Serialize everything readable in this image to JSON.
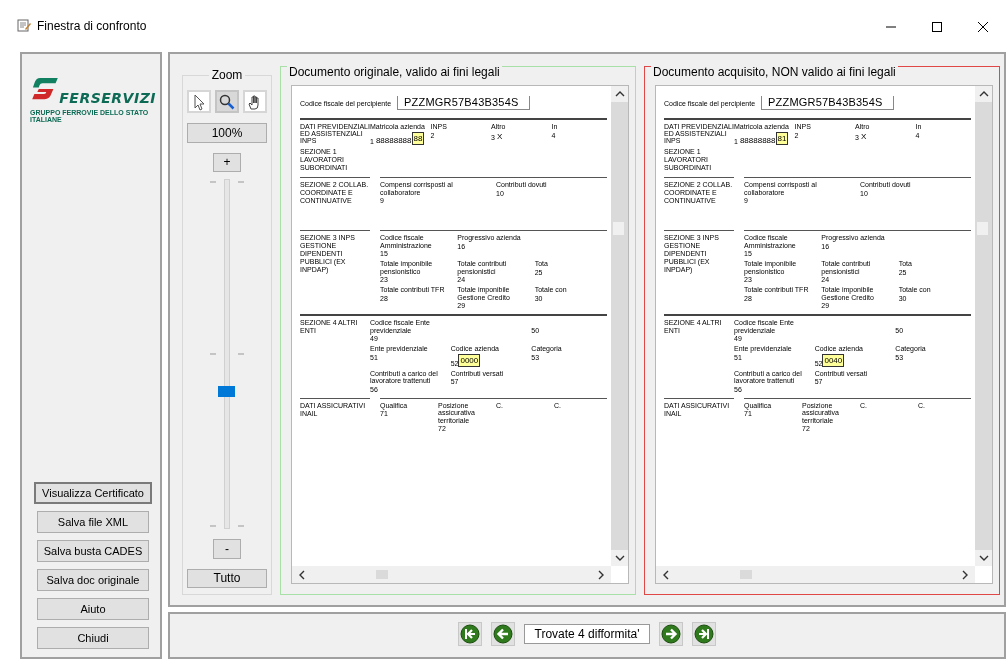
{
  "window": {
    "title": "Finestra di confronto"
  },
  "sidebar": {
    "logo": {
      "name": "FERSERVIZI",
      "tagline": "GRUPPO FERROVIE DELLO STATO ITALIANE"
    },
    "buttons": [
      {
        "label": "Visualizza Certificato",
        "focused": true
      },
      {
        "label": "Salva file XML",
        "focused": false
      },
      {
        "label": "Salva busta CADES",
        "focused": false
      },
      {
        "label": "Salva doc originale",
        "focused": false
      },
      {
        "label": "Aiuto",
        "focused": false
      },
      {
        "label": "Chiudi",
        "focused": false
      }
    ]
  },
  "zoom": {
    "title": "Zoom",
    "tools": [
      {
        "kind": "pointer",
        "selected": false
      },
      {
        "kind": "magnifier",
        "selected": true
      },
      {
        "kind": "hand",
        "selected": false
      }
    ],
    "percent": "100%",
    "plus": "+",
    "minus": "-",
    "level": 0.39,
    "fit": "Tutto"
  },
  "documents": [
    {
      "title": "Documento originale, valido ai fini legali",
      "color": "#a8e0a8",
      "fiscal_label": "Codice fiscale del percipiente",
      "fiscal_code": "PZZMGR57B43B354S",
      "sections": [
        {
          "heading": "DATI PREVIDENZIALI ED ASSISTENZIALI INPS",
          "label": "SEZIONE 1 LAVORATORI SUBORDINATI",
          "rows": [
            [
              {
                "caption": "Matricola azienda",
                "num": "1",
                "value": "88888888",
                "diff": "88"
              },
              {
                "caption": "INPS",
                "num": "2"
              },
              {
                "caption": "Altro",
                "num": "3",
                "value": "X"
              },
              {
                "caption": "In",
                "num": "4"
              }
            ]
          ]
        },
        {
          "label": "SEZIONE 2 COLLAB. COORDINATE E CONTINUATIVE",
          "rows": [
            [
              {
                "caption": "Compensi corrisposti al collaboratore",
                "num": "9"
              },
              {
                "caption": "Contributi dovuti",
                "num": "10"
              }
            ]
          ]
        },
        {
          "label": "SEZIONE 3 INPS GESTIONE DIPENDENTI PUBBLICI (EX INPDAP)",
          "rows": [
            [
              {
                "caption": "Codice fiscale Amministrazione",
                "num": "15"
              },
              {
                "caption": "Progressivo azienda",
                "num": "16"
              }
            ],
            [
              {
                "caption": "Totale imponibile pensionistico",
                "num": "23"
              },
              {
                "caption": "Totale contributi pensionistici",
                "num": "24"
              },
              {
                "caption": "Tota",
                "num": "25"
              }
            ],
            [
              {
                "caption": "Totale contributi TFR",
                "num": "28"
              },
              {
                "caption": "Totale imponibile Gestione Credito",
                "num": "29"
              },
              {
                "caption": "Totale con",
                "num": "30"
              }
            ]
          ]
        },
        {
          "label": "SEZIONE 4 ALTRI ENTI",
          "rows": [
            [
              {
                "caption": "Codice fiscale Ente previdenziale",
                "num": "49"
              },
              "",
              {
                "num": "50"
              }
            ],
            [
              {
                "caption": "Ente previdenziale",
                "num": "51"
              },
              {
                "caption": "Codice azienda",
                "num": "52",
                "diff": "0000"
              },
              {
                "caption": "Categoria",
                "num": "53"
              }
            ],
            [
              {
                "caption": "Contributi a carico del lavoratore trattenuti",
                "num": "56"
              },
              {
                "caption": "Contributi versati",
                "num": "57"
              }
            ]
          ]
        },
        {
          "label": "DATI ASSICURATIVI INAIL",
          "rows": [
            [
              {
                "caption": "Qualifica",
                "num": "71"
              },
              {
                "caption": "Posizione assicurativa territoriale",
                "num": "72"
              },
              {
                "caption": "C."
              },
              {
                "caption": "C."
              }
            ]
          ]
        }
      ]
    },
    {
      "title": "Documento acquisito, NON valido ai fini legali",
      "color": "#e04848",
      "fiscal_label": "Codice fiscale del percipiente",
      "fiscal_code": "PZZMGR57B43B354S",
      "sections": [
        {
          "heading": "DATI PREVIDENZIALI ED ASSISTENZIALI INPS",
          "label": "SEZIONE 1 LAVORATORI SUBORDINATI",
          "rows": [
            [
              {
                "caption": "Matricola azienda",
                "num": "1",
                "value": "88888888",
                "diff": "81"
              },
              {
                "caption": "INPS",
                "num": "2"
              },
              {
                "caption": "Altro",
                "num": "3",
                "value": "X"
              },
              {
                "caption": "In",
                "num": "4"
              }
            ]
          ]
        },
        {
          "label": "SEZIONE 2 COLLAB. COORDINATE E CONTINUATIVE",
          "rows": [
            [
              {
                "caption": "Compensi corrisposti al collaboratore",
                "num": "9"
              },
              {
                "caption": "Contributi dovuti",
                "num": "10"
              }
            ]
          ]
        },
        {
          "label": "SEZIONE 3 INPS GESTIONE DIPENDENTI PUBBLICI (EX INPDAP)",
          "rows": [
            [
              {
                "caption": "Codice fiscale Amministrazione",
                "num": "15"
              },
              {
                "caption": "Progressivo azienda",
                "num": "16"
              }
            ],
            [
              {
                "caption": "Totale imponibile pensionistico",
                "num": "23"
              },
              {
                "caption": "Totale contributi pensionistici",
                "num": "24"
              },
              {
                "caption": "Tota",
                "num": "25"
              }
            ],
            [
              {
                "caption": "Totale contributi TFR",
                "num": "28"
              },
              {
                "caption": "Totale imponibile Gestione Credito",
                "num": "29"
              },
              {
                "caption": "Totale con",
                "num": "30"
              }
            ]
          ]
        },
        {
          "label": "SEZIONE 4 ALTRI ENTI",
          "rows": [
            [
              {
                "caption": "Codice fiscale Ente previdenziale",
                "num": "49"
              },
              "",
              {
                "num": "50"
              }
            ],
            [
              {
                "caption": "Ente previdenziale",
                "num": "51"
              },
              {
                "caption": "Codice azienda",
                "num": "52",
                "diff": "0040"
              },
              {
                "caption": "Categoria",
                "num": "53"
              }
            ],
            [
              {
                "caption": "Contributi a carico del lavoratore trattenuti",
                "num": "56"
              },
              {
                "caption": "Contributi versati",
                "num": "57"
              }
            ]
          ]
        },
        {
          "label": "DATI ASSICURATIVI INAIL",
          "rows": [
            [
              {
                "caption": "Qualifica",
                "num": "71"
              },
              {
                "caption": "Posizione assicurativa territoriale",
                "num": "72"
              },
              {
                "caption": "C."
              },
              {
                "caption": "C."
              }
            ]
          ]
        }
      ]
    }
  ],
  "navigation": {
    "status": "Trovate 4 difformita'"
  }
}
